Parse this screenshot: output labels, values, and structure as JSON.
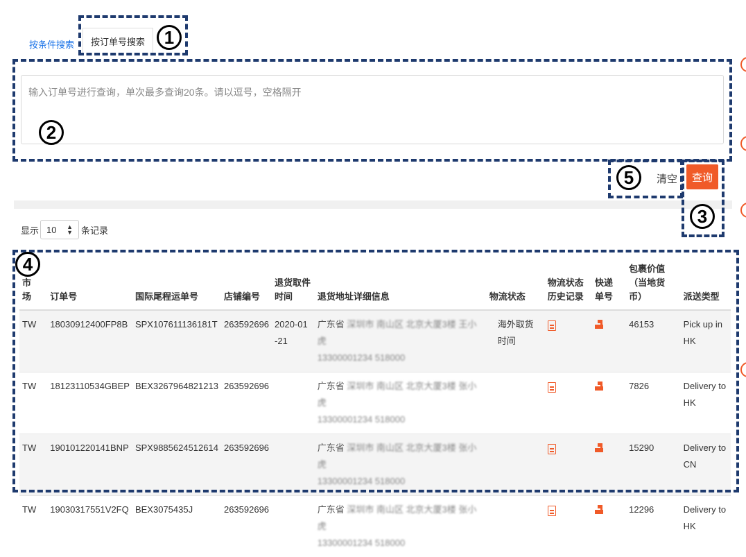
{
  "tabs": {
    "by_condition": "按条件搜索",
    "by_order": "按订单号搜索"
  },
  "search": {
    "placeholder": "输入订单号进行查询，单次最多查询20条。请以逗号，空格隔开"
  },
  "buttons": {
    "clear": "清空",
    "query": "查询"
  },
  "page_size": {
    "prefix": "显示",
    "value": "10",
    "suffix": "条记录"
  },
  "annotations": [
    "1",
    "2",
    "3",
    "4",
    "5"
  ],
  "colors": {
    "accent": "#f05a28",
    "link": "#1a73e8",
    "annotation": "#1e3a6e"
  },
  "table": {
    "headers": {
      "market": "市场",
      "order": "订单号",
      "tracking": "国际尾程运单号",
      "shop": "店铺编号",
      "pickup": "退货取件时间",
      "address": "退货地址详细信息",
      "status": "物流状态",
      "history": "物流状态历史记录",
      "courier": "快递单号",
      "value": "包裹价值（当地货币）",
      "type": "派送类型"
    },
    "rows": [
      {
        "market": "TW",
        "order": "18030912400FP8B",
        "tracking": "SPX107611136181T",
        "shop": "263592696",
        "pickup": "2020-01-21",
        "addr_prov": "广东省",
        "addr_rest": "深圳市 南山区 北京大厦3楼 王小虎",
        "addr_phone": "13300001234 518000",
        "status": "海外取货时间",
        "value": "46153",
        "type": "Pick up in HK"
      },
      {
        "market": "TW",
        "order": "18123110534GBEP",
        "tracking": "BEX3267964821213",
        "shop": "263592696",
        "pickup": "",
        "addr_prov": "广东省",
        "addr_rest": "深圳市 南山区 北京大厦3楼 张小虎",
        "addr_phone": "13300001234 518000",
        "status": "",
        "value": "7826",
        "type": "Delivery to HK"
      },
      {
        "market": "TW",
        "order": "190101220141BNP",
        "tracking": "SPX9885624512614",
        "shop": "263592696",
        "pickup": "",
        "addr_prov": "广东省",
        "addr_rest": "深圳市 南山区 北京大厦3楼 张小虎",
        "addr_phone": "13300001234 518000",
        "status": "",
        "value": "15290",
        "type": "Delivery to CN"
      },
      {
        "market": "TW",
        "order": "19030317551V2FQ",
        "tracking": "BEX3075435J",
        "shop": "263592696",
        "pickup": "",
        "addr_prov": "广东省",
        "addr_rest": "深圳市 南山区 北京大厦3楼 张小虎",
        "addr_phone": "13300001234 518000",
        "status": "",
        "value": "12296",
        "type": "Delivery to HK"
      }
    ]
  }
}
